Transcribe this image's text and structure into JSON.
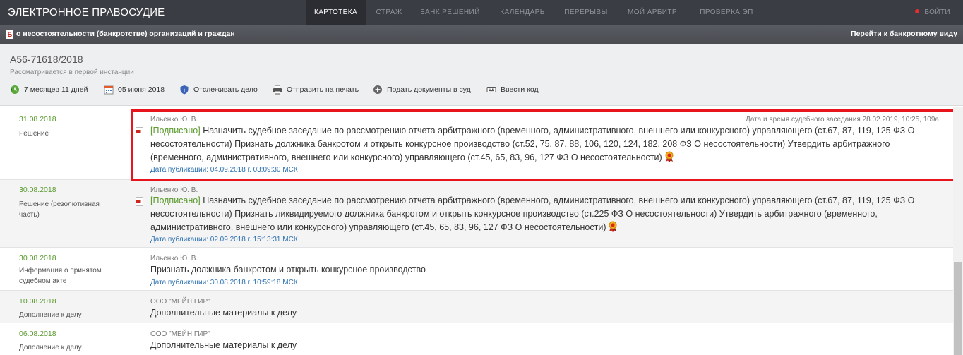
{
  "brand": "ЭЛЕКТРОННОЕ ПРАВОСУДИЕ",
  "nav": [
    "КАРТОТЕКА",
    "СТРАЖ",
    "БАНК РЕШЕНИЙ",
    "КАЛЕНДАРЬ",
    "ПЕРЕРЫВЫ",
    "МОЙ АРБИТР",
    "ПРОВЕРКА ЭП"
  ],
  "login": "ВОЙТИ",
  "bankruptcy": {
    "badge": "Б",
    "title": "о несостоятельности (банкротстве) организаций и граждан",
    "link": "Перейти к банкротному виду"
  },
  "case": {
    "number": "А56-71618/2018",
    "status": "Рассматривается в первой инстанции",
    "toolbar": [
      "7 месяцев 11 дней",
      "05 июня 2018",
      "Отслеживать дело",
      "Отправить на печать",
      "Подать документы в суд",
      "Ввести код"
    ]
  },
  "rows": [
    {
      "date": "31.08.2018",
      "type": "Решение",
      "judge": "Ильенко Ю. В.",
      "session": "Дата и время судебного заседания 28.02.2019, 10:25, 109а",
      "signed": "[Подписано]",
      "text": " Назначить судебное заседание по рассмотрению отчета арбитражного (временного, административного, внешнего или конкурсного) управляющего (ст.67, 87, 119, 125 ФЗ О несостоятельности) Признать должника банкротом и открыть конкурсное производство (ст.52, 75, 87, 88, 106, 120, 124, 182, 208 ФЗ О несостоятельности) Утвердить арбитражного (временного, административного, внешнего или конкурсного) управляющего (ст.45, 65, 83, 96, 127 ФЗ О несостоятельности)",
      "pub": "Дата публикации: 04.09.2018 г. 03:09:30 МСК"
    },
    {
      "date": "30.08.2018",
      "type": "Решение (резолютивная часть)",
      "judge": "Ильенко Ю. В.",
      "signed": "[Подписано]",
      "text": " Назначить судебное заседание по рассмотрению отчета арбитражного (временного, административного, внешнего или конкурсного) управляющего (ст.67, 87, 119, 125 ФЗ О несостоятельности) Признать ликвидируемого должника банкротом и открыть конкурсное производство (ст.225 ФЗ О несостоятельности) Утвердить арбитражного (временного, административного, внешнего или конкурсного) управляющего (ст.45, 65, 83, 96, 127 ФЗ О несостоятельности)",
      "pub": "Дата публикации: 02.09.2018 г. 15:13:31 МСК"
    },
    {
      "date": "30.08.2018",
      "type": "Информация о принятом судебном акте",
      "judge": "Ильенко Ю. В.",
      "text": "Признать должника банкротом и открыть конкурсное производство",
      "pub": "Дата публикации: 30.08.2018 г. 10:59:18 МСК"
    },
    {
      "date": "10.08.2018",
      "type": "Дополнение к делу",
      "judge": "ООО \"МЕЙН ГИР\"",
      "text": "Дополнительные материалы к делу"
    },
    {
      "date": "06.08.2018",
      "type": "Дополнение к делу",
      "judge": "ООО \"МЕЙН ГИР\"",
      "text": "Дополнительные материалы к делу"
    }
  ]
}
